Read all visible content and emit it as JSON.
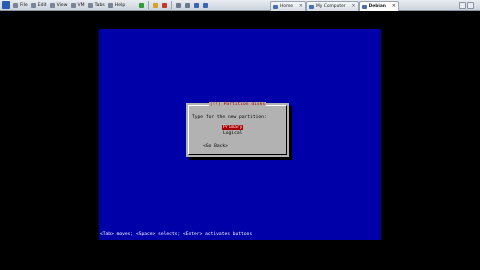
{
  "host": {
    "menu": [
      "File",
      "Edit",
      "View",
      "VM",
      "Tabs",
      "Help"
    ],
    "toolbar_icons": [
      "power-icon",
      "suspend-icon",
      "revert-icon",
      "snapshot-icon",
      "snapshot-manager-icon",
      "fullscreen-icon",
      "unity-icon"
    ],
    "tabs": [
      {
        "label": "Home",
        "active": false
      },
      {
        "label": "My Computer",
        "active": false
      },
      {
        "label": "Debian",
        "active": true
      }
    ]
  },
  "installer": {
    "dialog_title": "[!!] Partition disks",
    "prompt": "Type for the new partition:",
    "options": [
      "Primary",
      "Logical"
    ],
    "selected_option": "Primary",
    "go_back": "<Go Back>",
    "help_line": "<Tab> moves; <Space> selects; <Enter> activates buttons"
  },
  "colors": {
    "guest_background": "#0000a8",
    "dialog_background": "#b2b2b2",
    "selection_background": "#a80000"
  }
}
